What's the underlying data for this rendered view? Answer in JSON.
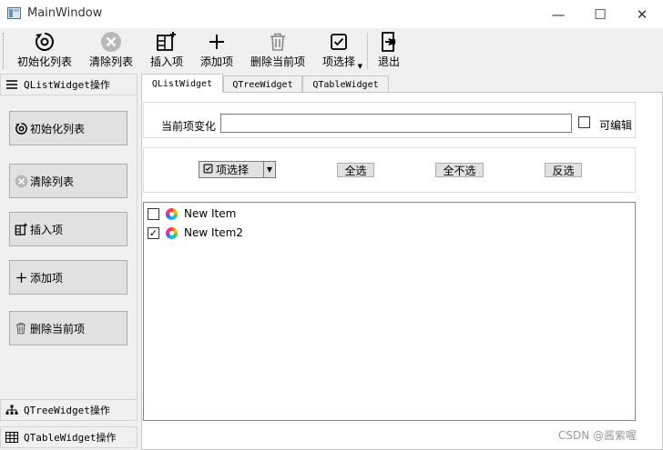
{
  "window": {
    "title": "MainWindow",
    "minimize_glyph": "—",
    "maximize_glyph": "☐",
    "close_glyph": "✕"
  },
  "toolbar": {
    "items": [
      {
        "label": "初始化列表",
        "icon": "refresh-icon"
      },
      {
        "label": "清除列表",
        "icon": "clear-icon"
      },
      {
        "label": "插入项",
        "icon": "insert-icon"
      },
      {
        "label": "添加项",
        "icon": "plus-icon"
      },
      {
        "label": "删除当前项",
        "icon": "trash-icon"
      },
      {
        "label": "项选择",
        "icon": "checkbox-icon"
      },
      {
        "label": "退出",
        "icon": "exit-icon"
      }
    ]
  },
  "dock": {
    "top_title": "QListWidget操作",
    "buttons": [
      {
        "label": "初始化列表",
        "icon": "refresh-icon"
      },
      {
        "label": "清除列表",
        "icon": "clear-icon"
      },
      {
        "label": "插入项",
        "icon": "insert-icon"
      },
      {
        "label": "添加项",
        "icon": "plus-icon"
      },
      {
        "label": "删除当前项",
        "icon": "trash-icon"
      }
    ],
    "tree_title": "QTreeWidget操作",
    "table_title": "QTableWidget操作"
  },
  "tabs": [
    {
      "label": "QListWidget",
      "active": true
    },
    {
      "label": "QTreeWidget",
      "active": false
    },
    {
      "label": "QTableWidget",
      "active": false
    }
  ],
  "current_item": {
    "label": "当前项变化",
    "value": "",
    "editable_label": "可编辑",
    "editable_checked": false
  },
  "selection": {
    "dropdown_label": "项选择",
    "select_all": "全选",
    "select_none": "全不选",
    "invert": "反选"
  },
  "list": {
    "items": [
      {
        "text": "New Item",
        "checked": false
      },
      {
        "text": "New Item2",
        "checked": true
      }
    ]
  },
  "watermark": "CSDN @酱紫喔"
}
